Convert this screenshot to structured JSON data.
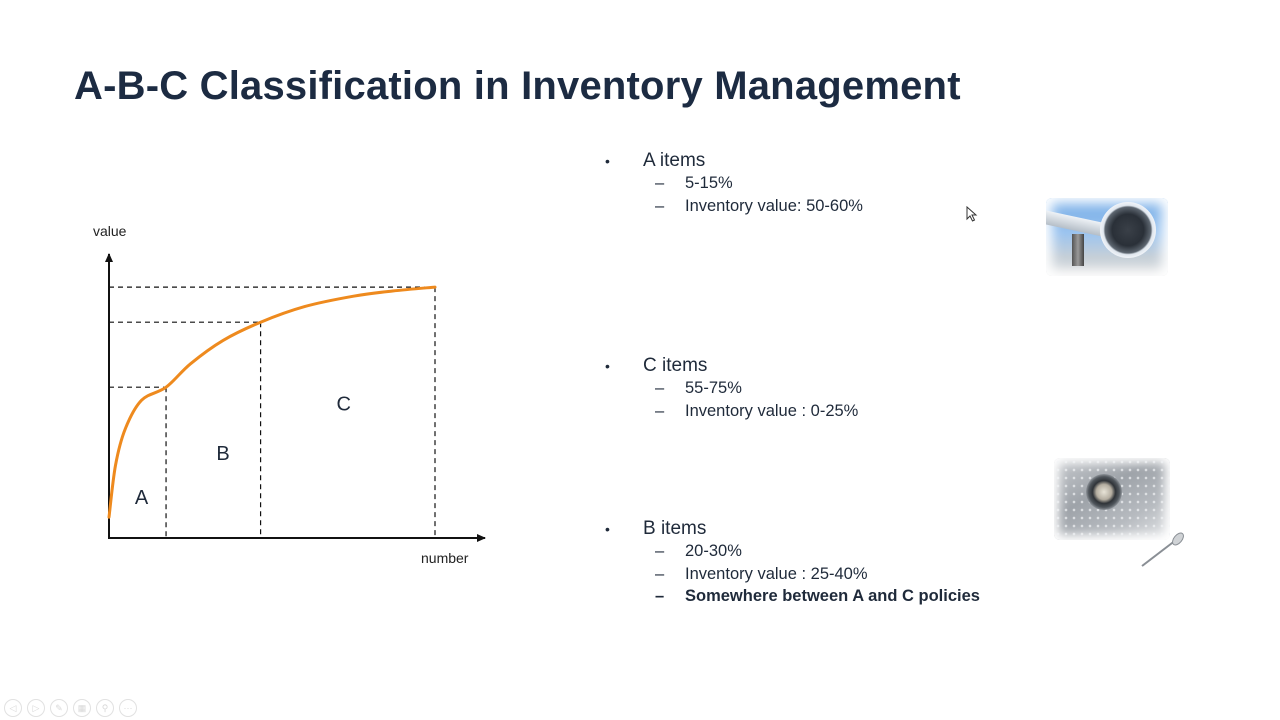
{
  "slide": {
    "title": "A-B-C Classification in Inventory Management"
  },
  "chart_data": {
    "type": "line",
    "title": "",
    "xlabel": "number",
    "ylabel": "value",
    "xlim": [
      0,
      100
    ],
    "ylim": [
      0,
      100
    ],
    "curve": "concave cumulative value curve (Pareto-style)",
    "curve_color": "#ee8a1e",
    "points": [
      {
        "x": 0,
        "y": 8
      },
      {
        "x": 2,
        "y": 28
      },
      {
        "x": 5,
        "y": 42
      },
      {
        "x": 10,
        "y": 53
      },
      {
        "x": 17.5,
        "y": 58
      },
      {
        "x": 25,
        "y": 67
      },
      {
        "x": 35,
        "y": 76
      },
      {
        "x": 46.5,
        "y": 83
      },
      {
        "x": 60,
        "y": 89
      },
      {
        "x": 75,
        "y": 93
      },
      {
        "x": 87,
        "y": 95
      },
      {
        "x": 100,
        "y": 96.5
      }
    ],
    "boundaries": [
      {
        "x": 17.5,
        "y": 58
      },
      {
        "x": 46.5,
        "y": 83
      },
      {
        "x": 100,
        "y": 96.5
      }
    ],
    "regions": [
      {
        "label": "A",
        "x": 10,
        "y": 13
      },
      {
        "label": "B",
        "x": 35,
        "y": 30
      },
      {
        "label": "C",
        "x": 72,
        "y": 49
      }
    ]
  },
  "bullets": [
    {
      "label": "A items",
      "subitems": [
        {
          "text": "5-15%",
          "bold": false
        },
        {
          "text": "Inventory value: 50-60%",
          "bold": false
        }
      ]
    },
    {
      "label": "C items",
      "subitems": [
        {
          "text": "55-75%",
          "bold": false
        },
        {
          "text": "Inventory value : 0-25%",
          "bold": false
        }
      ]
    },
    {
      "label": "B items",
      "subitems": [
        {
          "text": "20-30%",
          "bold": false
        },
        {
          "text": "Inventory value : 25-40%",
          "bold": false
        },
        {
          "text": "Somewhere between A and C policies",
          "bold": true
        }
      ]
    }
  ],
  "glyphs": {
    "bullet": "•",
    "dash": "–"
  },
  "toolbar": {
    "buttons": [
      {
        "name": "previous-slide-button",
        "glyph": "◁"
      },
      {
        "name": "next-slide-button",
        "glyph": "▷"
      },
      {
        "name": "pen-button",
        "glyph": "✎"
      },
      {
        "name": "slides-button",
        "glyph": "▦"
      },
      {
        "name": "zoom-button",
        "glyph": "⚲"
      },
      {
        "name": "more-options-button",
        "glyph": "···"
      }
    ]
  }
}
